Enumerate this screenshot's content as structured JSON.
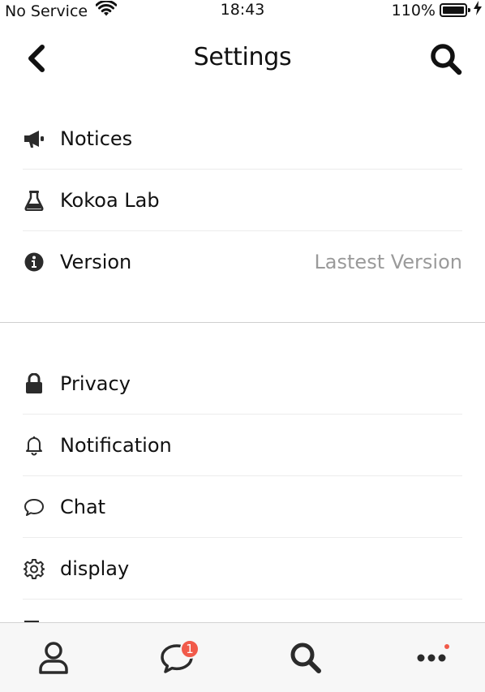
{
  "status_bar": {
    "carrier": "No Service",
    "time": "18:43",
    "battery": "110%"
  },
  "header": {
    "title": "Settings"
  },
  "section1": {
    "items": [
      {
        "label": "Notices",
        "icon": "megaphone-icon"
      },
      {
        "label": "Kokoa Lab",
        "icon": "flask-icon"
      },
      {
        "label": "Version",
        "icon": "info-icon",
        "value": "Lastest Version"
      }
    ]
  },
  "section2": {
    "items": [
      {
        "label": "Privacy",
        "icon": "lock-icon"
      },
      {
        "label": "Notification",
        "icon": "bell-icon"
      },
      {
        "label": "Chat",
        "icon": "chat-bubble-icon"
      },
      {
        "label": "display",
        "icon": "gear-icon"
      }
    ]
  },
  "tabbar": {
    "tabs": [
      {
        "name": "friends",
        "icon": "person-icon"
      },
      {
        "name": "chats",
        "icon": "chat-icon",
        "badge": "1"
      },
      {
        "name": "search",
        "icon": "search-icon"
      },
      {
        "name": "more",
        "icon": "more-icon"
      }
    ]
  },
  "colors": {
    "badge": "#f15a4a",
    "secondary_text": "#9a9a9a",
    "tabbar_bg": "#f7f7f7"
  }
}
